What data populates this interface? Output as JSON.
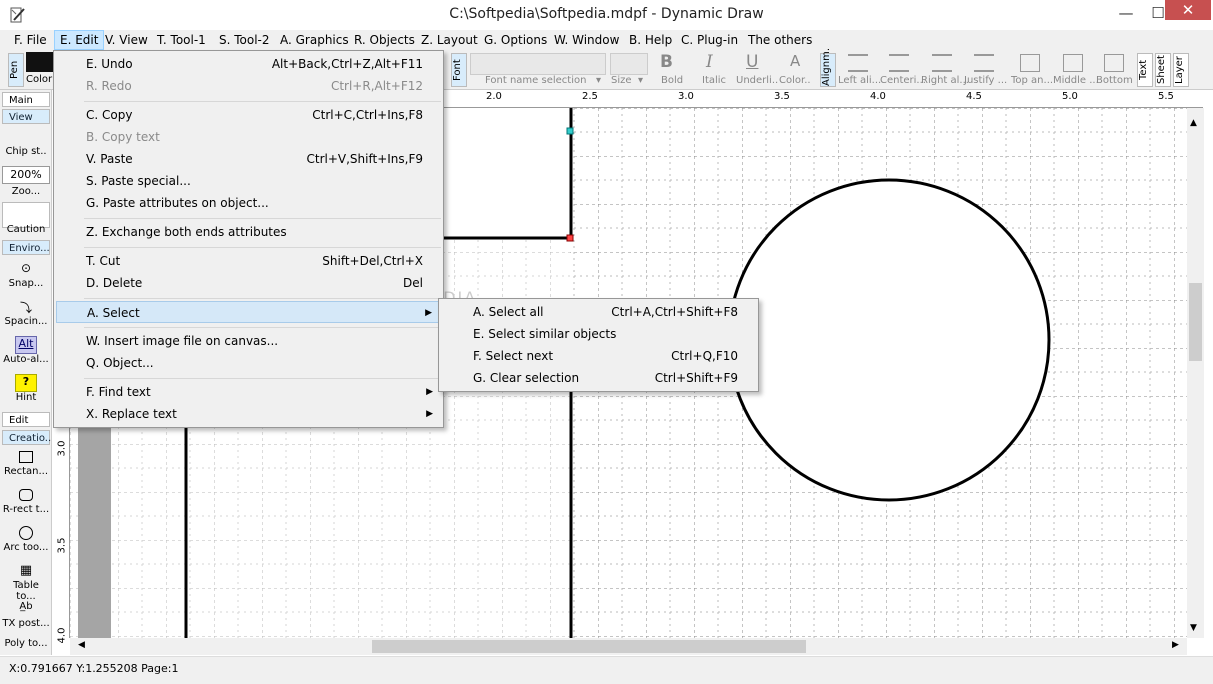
{
  "window": {
    "title": "C:\\Softpedia\\Softpedia.mdpf - Dynamic Draw",
    "minimize": "—",
    "maximize": "☐",
    "close": "✕"
  },
  "menubar": [
    "F. File",
    "E. Edit",
    "V. View",
    "T. Tool-1",
    "S. Tool-2",
    "A. Graphics",
    "R. Objects",
    "Z. Layout",
    "G. Options",
    "W. Window",
    "B. Help",
    "C. Plug-in",
    "The others"
  ],
  "toolbar": {
    "pen_tab": "Pen",
    "color_label": "Color",
    "font_tab": "Font",
    "font_name_placeholder": "Font name selection",
    "size_label": "Size",
    "bold": "Bold",
    "bold_glyph": "B",
    "italic": "Italic",
    "italic_glyph": "I",
    "underline": "Underli..",
    "underline_glyph": "U",
    "color": "Color..",
    "color_glyph": "A",
    "alignment_tab": "Alignm.",
    "align_buttons": [
      "Left ali...",
      "Centeri...",
      "Right al...",
      "Justify ..."
    ],
    "valign_buttons": [
      "Top an...",
      "Middle ...",
      "Bottom ..."
    ],
    "side_tabs": [
      "Text",
      "Sheet",
      "Layer"
    ]
  },
  "left_panel": {
    "main": "Main",
    "view": "View",
    "chip": "Chip st..",
    "zoom_value": "200%",
    "zoom": "Zoo...",
    "caution": "Caution",
    "enviro": "Enviro...",
    "snap": "Snap...",
    "spacing": "Spacin...",
    "auto_glyph": "Alt",
    "auto": "Auto-al...",
    "hint_glyph": "?",
    "hint": "Hint",
    "edit_tool": "Edit too...",
    "creation": "Creatio...",
    "rect": "Rectan...",
    "rrect": "R-rect t...",
    "arc": "Arc too...",
    "table": "Table to...",
    "txpost": "TX post...",
    "poly": "Poly to..."
  },
  "ruler": {
    "top": [
      "2.0",
      "2.5",
      "3.0",
      "3.5",
      "4.0",
      "4.5",
      "5.0",
      "5.5"
    ],
    "left": [
      "3.0",
      "3.5",
      "4.0"
    ]
  },
  "edit_menu": [
    {
      "label": "E. Undo",
      "shortcut": "Alt+Back,Ctrl+Z,Alt+F11",
      "disabled": false
    },
    {
      "label": "R. Redo",
      "shortcut": "Ctrl+R,Alt+F12",
      "disabled": true
    },
    {
      "label": "C. Copy",
      "shortcut": "Ctrl+C,Ctrl+Ins,F8",
      "disabled": false
    },
    {
      "label": "B. Copy text",
      "shortcut": "",
      "disabled": true
    },
    {
      "label": "V. Paste",
      "shortcut": "Ctrl+V,Shift+Ins,F9",
      "disabled": false
    },
    {
      "label": "S. Paste special...",
      "shortcut": "",
      "disabled": false
    },
    {
      "label": "G. Paste attributes on object...",
      "shortcut": "",
      "disabled": false
    },
    {
      "label": "Z. Exchange both ends attributes",
      "shortcut": "",
      "disabled": false
    },
    {
      "label": "T. Cut",
      "shortcut": "Shift+Del,Ctrl+X",
      "disabled": false
    },
    {
      "label": "D. Delete",
      "shortcut": "Del",
      "disabled": false
    },
    {
      "label": "A. Select",
      "shortcut": "",
      "disabled": false,
      "submenu": true
    },
    {
      "label": "W. Insert image file on canvas...",
      "shortcut": "",
      "disabled": false
    },
    {
      "label": "Q. Object...",
      "shortcut": "",
      "disabled": false
    },
    {
      "label": "F. Find text",
      "shortcut": "",
      "disabled": false,
      "submenu": true
    },
    {
      "label": "X. Replace text",
      "shortcut": "",
      "disabled": false,
      "submenu": true
    }
  ],
  "select_submenu": [
    {
      "label": "A. Select all",
      "shortcut": "Ctrl+A,Ctrl+Shift+F8"
    },
    {
      "label": "E. Select similar objects",
      "shortcut": ""
    },
    {
      "label": "F. Select next",
      "shortcut": "Ctrl+Q,F10"
    },
    {
      "label": "G. Clear selection",
      "shortcut": "Ctrl+Shift+F9"
    }
  ],
  "status": {
    "coords": "X:0.791667 Y:1.255208 Page:1"
  },
  "watermark": "SOFTPEDIA"
}
